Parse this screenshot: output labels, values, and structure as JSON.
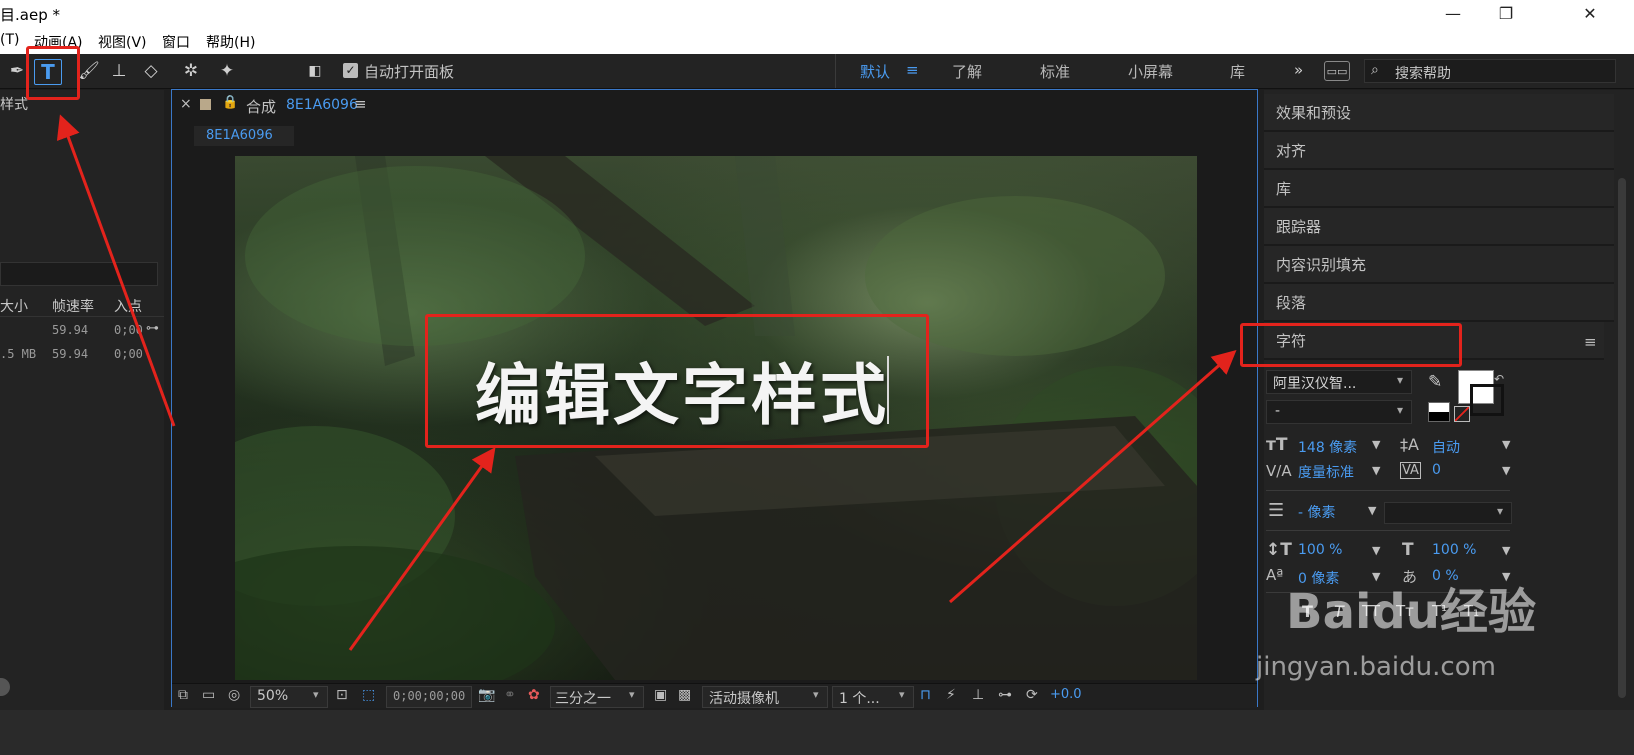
{
  "window": {
    "title": "目.aep *",
    "minimize": "—",
    "restore": "❐",
    "close": "✕"
  },
  "menu": [
    "(T)",
    "动画(A)",
    "视图(V)",
    "窗口",
    "帮助(H)"
  ],
  "toolbar": {
    "auto_open_panel": "自动打开面板",
    "workspaces": [
      "默认",
      "了解",
      "标准",
      "小屏幕",
      "库"
    ],
    "workspace_menu_icon": "≡",
    "more": "»",
    "search_placeholder": "搜索帮助"
  },
  "left_panel": {
    "title": "样式",
    "columns": [
      "大小",
      "帧速率",
      "入点"
    ],
    "rows": [
      {
        "size": "",
        "fps": "59.94",
        "in": "0;00"
      },
      {
        "size": ".5 MB",
        "fps": "59.94",
        "in": "0;00"
      }
    ]
  },
  "comp": {
    "tab_close": "×",
    "tab_label": "合成",
    "tab_name": "8E1A6096",
    "tab_menu": "≡",
    "breadcrumb": "8E1A6096",
    "viewer_text": "编辑文字样式",
    "bottom": {
      "zoom": "50%",
      "timecode": "0;00;00;00",
      "resolution": "三分之一",
      "camera": "活动摄像机",
      "views": "1 个...",
      "exposure": "+0.0"
    }
  },
  "right_panel": {
    "panels": [
      "效果和预设",
      "对齐",
      "库",
      "跟踪器",
      "内容识别填充",
      "段落",
      "字符"
    ],
    "character": {
      "menu_icon": "≡",
      "font": "阿里汉仪智...",
      "style": "-",
      "font_size": "148 像素",
      "leading": "自动",
      "kerning": "度量标准",
      "tracking": "0",
      "stroke": "- 像素",
      "vert_scale": "100 %",
      "horiz_scale": "100 %",
      "baseline": "0 像素",
      "tsume": "0 %",
      "styles": [
        "T",
        "T",
        "TT",
        "Tт",
        "T¹",
        "T₁"
      ]
    },
    "colors": {
      "fill": "#ffffff",
      "stroke": "#000000"
    }
  },
  "watermark": {
    "brand": "Baidu经验",
    "url": "jingyan.baidu.com"
  },
  "colors": {
    "accent": "#3a78c8",
    "highlight": "#e3231c",
    "blue_value": "#4a9bf0"
  }
}
